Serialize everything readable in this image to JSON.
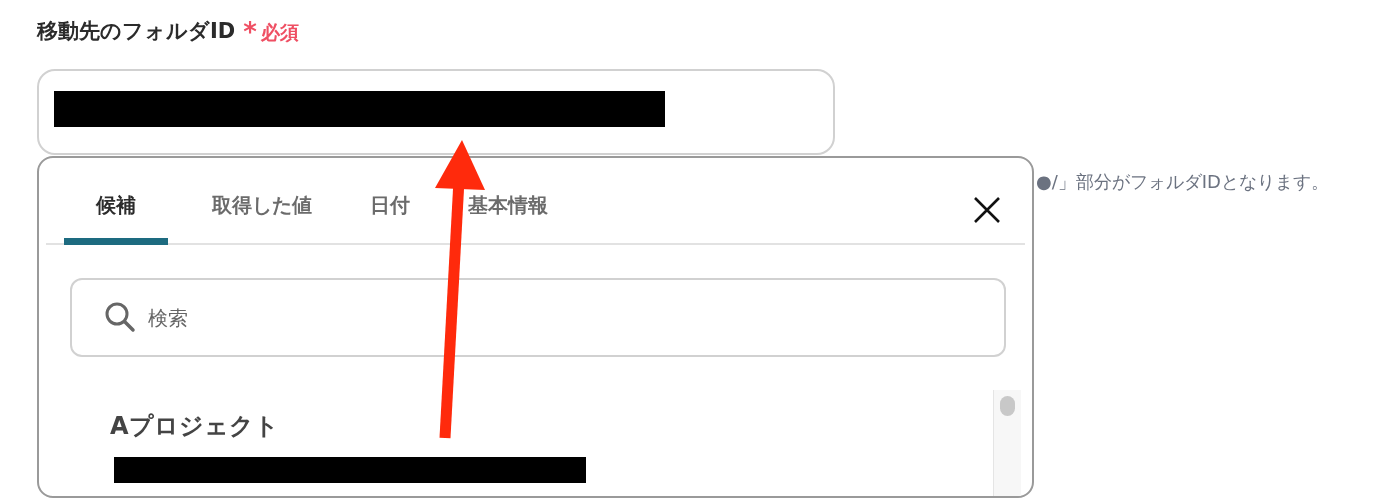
{
  "field": {
    "label": "移動先のフォルダID",
    "required_mark": "*",
    "required_text": "必須",
    "redacted": true
  },
  "hint": "●/」部分がフォルダIDとなります。",
  "popup": {
    "tabs": [
      {
        "label": "候補",
        "selected": true
      },
      {
        "label": "取得した値",
        "selected": false
      },
      {
        "label": "日付",
        "selected": false
      },
      {
        "label": "基本情報",
        "selected": false
      }
    ],
    "search": {
      "placeholder": "検索"
    },
    "items": [
      {
        "title": "Aプロジェクト",
        "redacted": true
      }
    ]
  },
  "annotation": {
    "kind": "arrow"
  }
}
